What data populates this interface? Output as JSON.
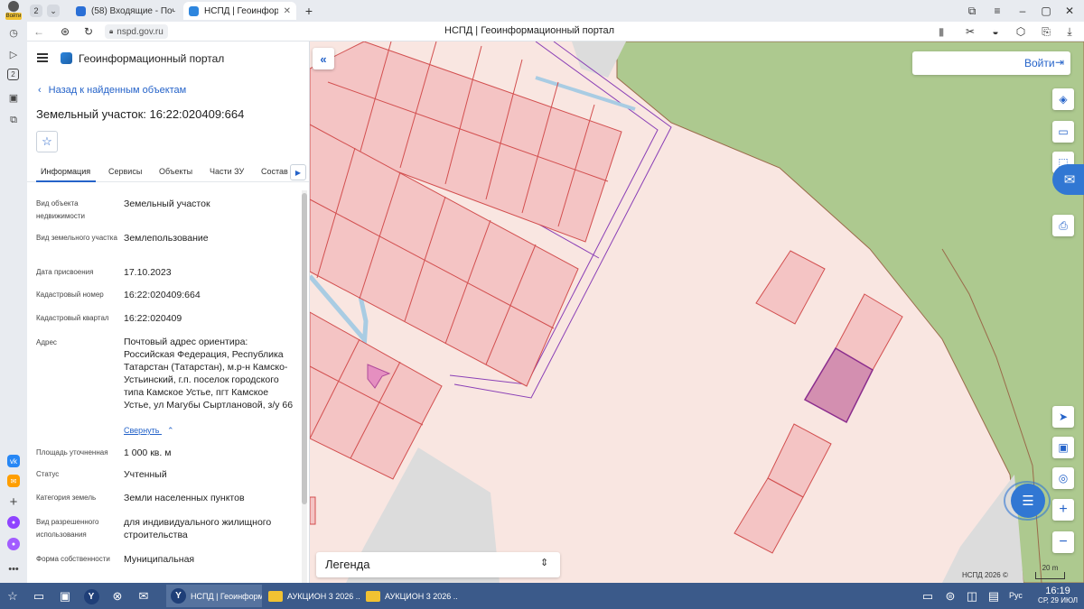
{
  "browser": {
    "profile_label": "Войти",
    "tab_count": "2",
    "tabs": [
      {
        "title": "(58) Входящие - Почта Mail",
        "active": false
      },
      {
        "title": "НСПД | Геоинформационный портал",
        "active": true
      }
    ],
    "new_tab": "+",
    "window_title": "НСПД | Геоинформационный портал",
    "url": "nspd.gov.ru"
  },
  "sidebar": {
    "portal_title": "Геоинформационный портал",
    "back_link": "Назад к найденным объектам",
    "object_title": "Земельный участок: 16:22:020409:664",
    "tabs": [
      "Информация",
      "Сервисы",
      "Объекты",
      "Части ЗУ",
      "Состав"
    ],
    "fields": [
      {
        "label": "Вид объекта недвижимости",
        "value": "Земельный участок"
      },
      {
        "label": "Вид земельного участка",
        "value": "Землепользование"
      },
      {
        "label": "Дата присвоения",
        "value": "17.10.2023"
      },
      {
        "label": "Кадастровый номер",
        "value": "16:22:020409:664"
      },
      {
        "label": "Кадастровый квартал",
        "value": "16:22:020409"
      },
      {
        "label": "Адрес",
        "value": "Почтовый адрес ориентира: Российская Федерация, Республика Татарстан (Татарстан), м.р-н Камско-Устьинский, г.п. поселок городского типа Камское Устье, пгт Камское Устье, ул Магубы Сыртлановой, з/у 66"
      },
      {
        "label": "Площадь уточненная",
        "value": "1 000 кв. м"
      },
      {
        "label": "Статус",
        "value": "Учтенный"
      },
      {
        "label": "Категория земель",
        "value": "Земли населенных пунктов"
      },
      {
        "label": "Вид разрешенного использования",
        "value": "для индивидуального жилищного строительства"
      },
      {
        "label": "Форма собственности",
        "value": "Муниципальная"
      }
    ],
    "collapse_link": "Свернуть"
  },
  "map": {
    "login_label": "Войти",
    "legend_label": "Легенда",
    "attribution": "НСПД 2026 ©",
    "scale_label": "20 m",
    "colors": {
      "background": "#f9e6e1",
      "parcel_fill": "#f4c4c4",
      "parcel_stroke": "#d24f4f",
      "selected_fill": "#d38fb0",
      "selected_stroke": "#8b2d8d",
      "green_zone": "#adc98f",
      "grey_zone": "#dcdcdc",
      "boundary_line": "#8a3fb6",
      "water_line": "#a9cce3"
    }
  },
  "taskbar": {
    "tasks": [
      {
        "title": "НСПД | Геоинформ...",
        "active": true
      },
      {
        "title": "АУКЦИОН 3 2026 ...",
        "active": false
      },
      {
        "title": "АУКЦИОН 3 2026 ...",
        "active": false
      }
    ],
    "language": "Рус",
    "time": "16:19",
    "date": "СР, 29 ИЮЛ"
  }
}
